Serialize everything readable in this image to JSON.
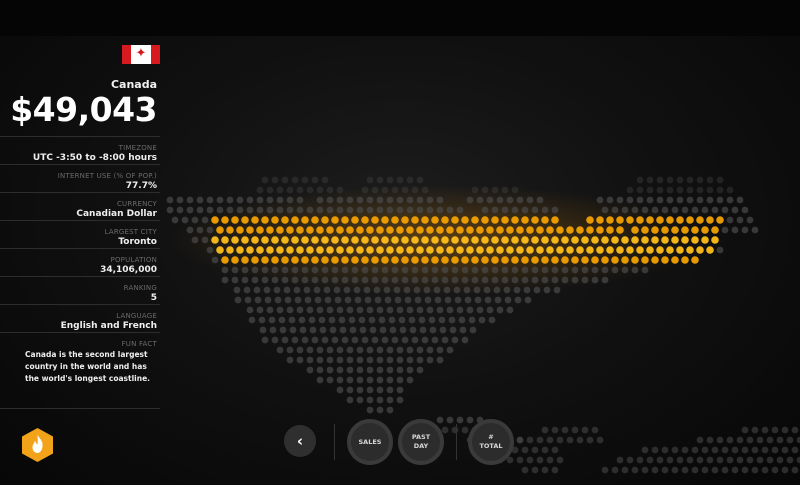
{
  "country": {
    "name": "Canada",
    "flag_icon": "canada-flag-icon",
    "amount": "$49,043",
    "flag_colors": {
      "red": "#d71920",
      "white": "#ffffff"
    }
  },
  "stats": [
    {
      "label": "TIMEZONE",
      "value": "UTC -3:50 to -8:00 hours"
    },
    {
      "label": "INTERNET USE (% OF POP.)",
      "value": "77.7%"
    },
    {
      "label": "CURRENCY",
      "value": "Canadian Dollar"
    },
    {
      "label": "LARGEST CITY",
      "value": "Toronto"
    },
    {
      "label": "POPULATION",
      "value": "34,106,000"
    },
    {
      "label": "RANKING",
      "value": "5"
    },
    {
      "label": "LANGUAGE",
      "value": "English and French"
    }
  ],
  "fun_fact": {
    "label": "FUN FACT",
    "text": "Canada is the second largest country in the world and has the world's longest coastline."
  },
  "nav": {
    "back_icon": "chevron-left-icon",
    "back_glyph": "‹",
    "sales": "SALES",
    "past_day": "PAST DAY",
    "total": "# TOTAL"
  },
  "logo_icon": "flame-hexagon-logo-icon",
  "colors": {
    "highlight": "#f2a100",
    "highlight_glow": "#ffbf1a",
    "dot_grey": "#4a4a4a",
    "logo": "#f2a31a"
  }
}
